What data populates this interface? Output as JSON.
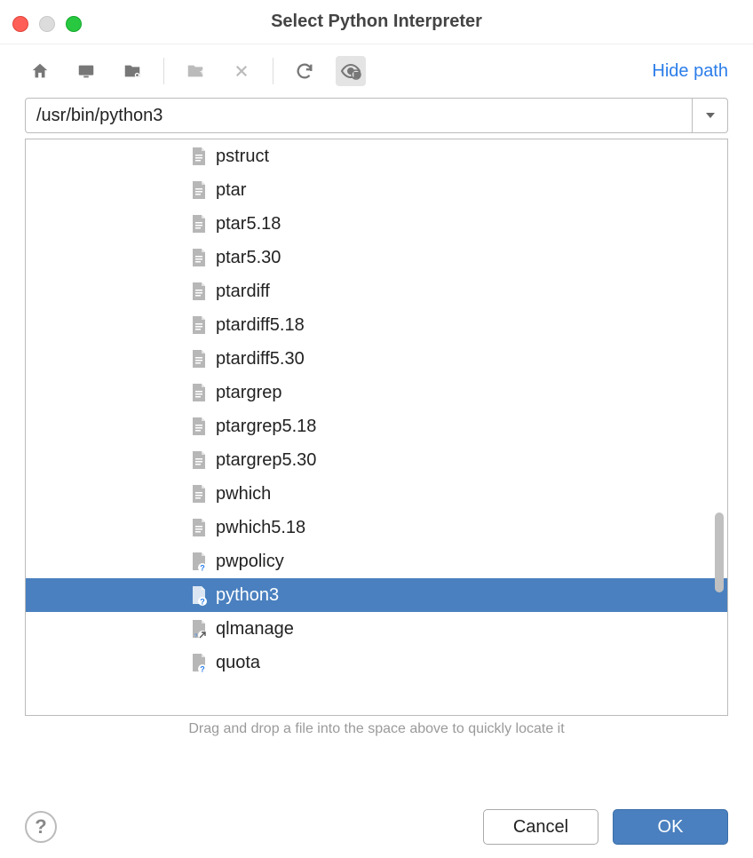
{
  "title": "Select Python Interpreter",
  "toolbar": {
    "hide_path": "Hide path"
  },
  "path": {
    "value": "/usr/bin/python3"
  },
  "files": [
    {
      "name": "pstruct",
      "kind": "text"
    },
    {
      "name": "ptar",
      "kind": "text"
    },
    {
      "name": "ptar5.18",
      "kind": "text"
    },
    {
      "name": "ptar5.30",
      "kind": "text"
    },
    {
      "name": "ptardiff",
      "kind": "text"
    },
    {
      "name": "ptardiff5.18",
      "kind": "text"
    },
    {
      "name": "ptardiff5.30",
      "kind": "text"
    },
    {
      "name": "ptargrep",
      "kind": "text"
    },
    {
      "name": "ptargrep5.18",
      "kind": "text"
    },
    {
      "name": "ptargrep5.30",
      "kind": "text"
    },
    {
      "name": "pwhich",
      "kind": "text"
    },
    {
      "name": "pwhich5.18",
      "kind": "text"
    },
    {
      "name": "pwpolicy",
      "kind": "unknown"
    },
    {
      "name": "python3",
      "kind": "unknown",
      "selected": true
    },
    {
      "name": "qlmanage",
      "kind": "link"
    },
    {
      "name": "quota",
      "kind": "unknown"
    }
  ],
  "hint": "Drag and drop a file into the space above to quickly locate it",
  "buttons": {
    "cancel": "Cancel",
    "ok": "OK"
  }
}
